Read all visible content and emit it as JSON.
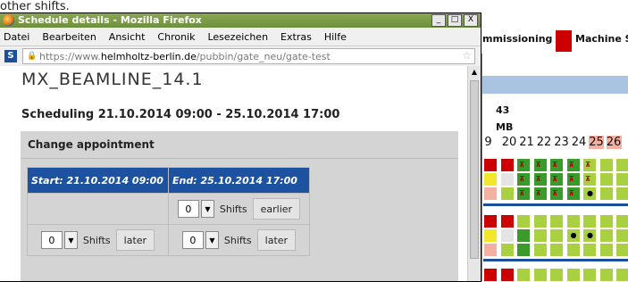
{
  "background": {
    "top_text": "other shifts.",
    "header_text_1": "mmissioning",
    "header_text_2": "Machine S",
    "week": "43",
    "mb": "MB",
    "days": [
      "9",
      "20",
      "21",
      "22",
      "23",
      "24",
      "25",
      "26"
    ],
    "colors": {
      "red": "#cc0000",
      "green": "#3a9a2a",
      "lime": "#a8d040",
      "yellow": "#f4e62a",
      "pink": "#f4b0a0",
      "grey": "#e4e4e4",
      "blue": "#1b4f9c",
      "lightgreen": "#b7dc6a"
    }
  },
  "window": {
    "title": "Schedule details - Mozilla Firefox",
    "buttons": [
      "_",
      "□",
      "X"
    ],
    "menu": [
      "Datei",
      "Bearbeiten",
      "Ansicht",
      "Chronik",
      "Lesezeichen",
      "Extras",
      "Hilfe"
    ],
    "url_prefix": "https://www.",
    "url_domain": "helmholtz-berlin.de",
    "url_path": "/pubbin/gate_neu/gate-test"
  },
  "page": {
    "title": "MX_BEAMLINE_14.1",
    "scheduling": "Scheduling 21.10.2014 09:00 - 25.10.2014 17:00",
    "panel_title": "Change appointment",
    "start_header": "Start: 21.10.2014 09:00",
    "end_header": "End: 25.10.2014 17:00",
    "shifts_value_1": "0",
    "shifts_value_2": "0",
    "shifts_value_3": "0",
    "shifts_label": "Shifts",
    "earlier_label": "earlier",
    "later_label": "later"
  }
}
